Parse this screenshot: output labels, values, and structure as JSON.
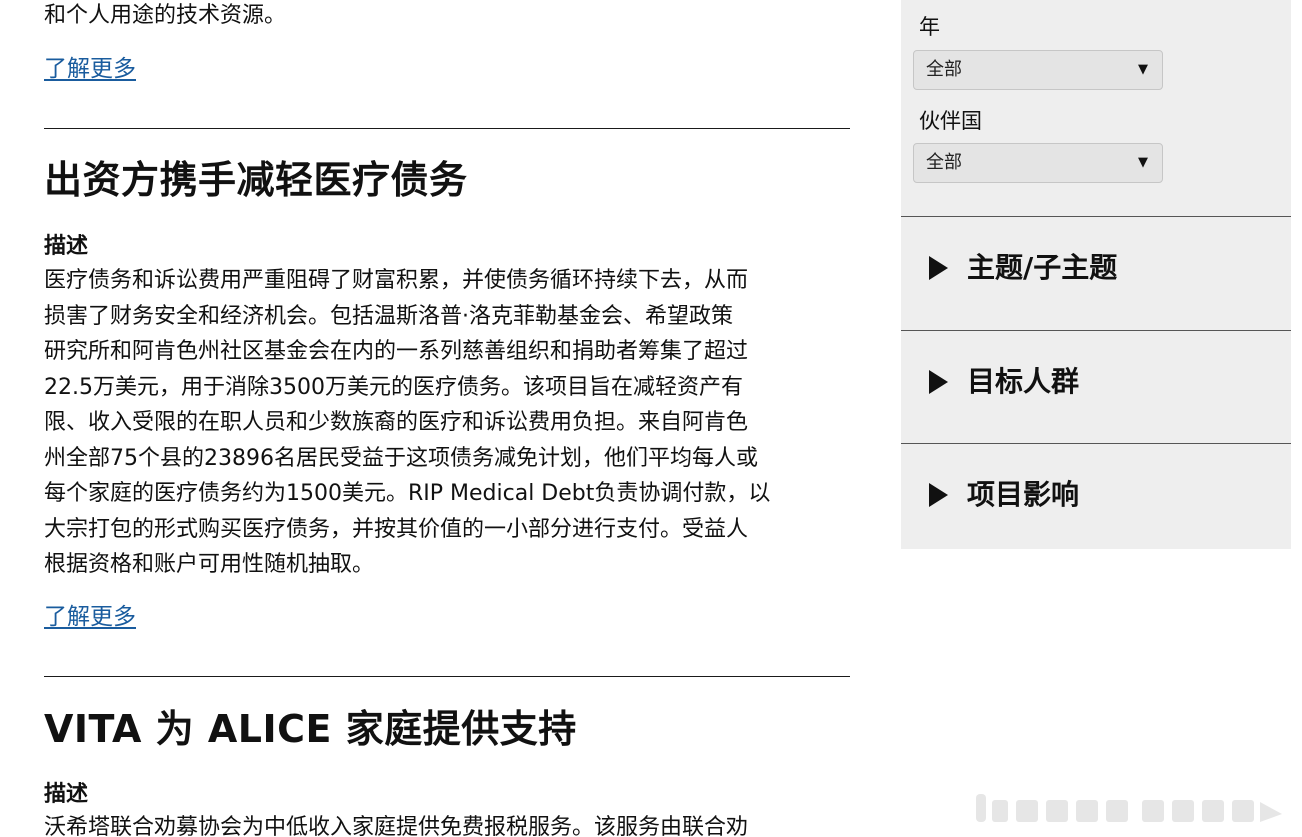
{
  "intro": {
    "tail_text": "和个人用途的技术资源。",
    "learn_more": "了解更多"
  },
  "cards": [
    {
      "title": "出资方携手减轻医疗债务",
      "desc_label": "描述",
      "desc_lines": [
        "医疗债务和诉讼费用严重阻碍了财富积累，并使债务循环持续下去，从而",
        "损害了财务安全和经济机会。包括温斯洛普·洛克菲勒基金会、希望政策",
        "研究所和阿肯色州社区基金会在内的一系列慈善组织和捐助者筹集了超过",
        "22.5万美元，用于消除3500万美元的医疗债务。该项目旨在减轻资产有",
        "限、收入受限的在职人员和少数族裔的医疗和诉讼费用负担。来自阿肯色",
        "州全部75个县的23896名居民受益于这项债务减免计划，他们平均每人或",
        "每个家庭的医疗债务约为1500美元。RIP Medical Debt负责协调付款，以",
        "大宗打包的形式购买医疗债务，并按其价值的一小部分进行支付。受益人",
        "根据资格和账户可用性随机抽取。"
      ],
      "learn_more": "了解更多"
    },
    {
      "title": "VITA 为 ALICE 家庭提供支持",
      "desc_label": "描述",
      "desc_lines": [
        "沃希塔联合劝募协会为中低收入家庭提供免费报税服务。该服务由联合劝"
      ]
    }
  ],
  "sidebar": {
    "filters": [
      {
        "label": "年",
        "selected": "全部"
      },
      {
        "label": "伙伴国",
        "selected": "全部"
      }
    ],
    "accordions": [
      {
        "label": "主题/子主题"
      },
      {
        "label": "目标人群"
      },
      {
        "label": "项目影响"
      }
    ]
  },
  "colors": {
    "link": "#1a5c9e",
    "sidebar_bg": "#eeeeee",
    "select_bg": "#e4e4e4"
  }
}
